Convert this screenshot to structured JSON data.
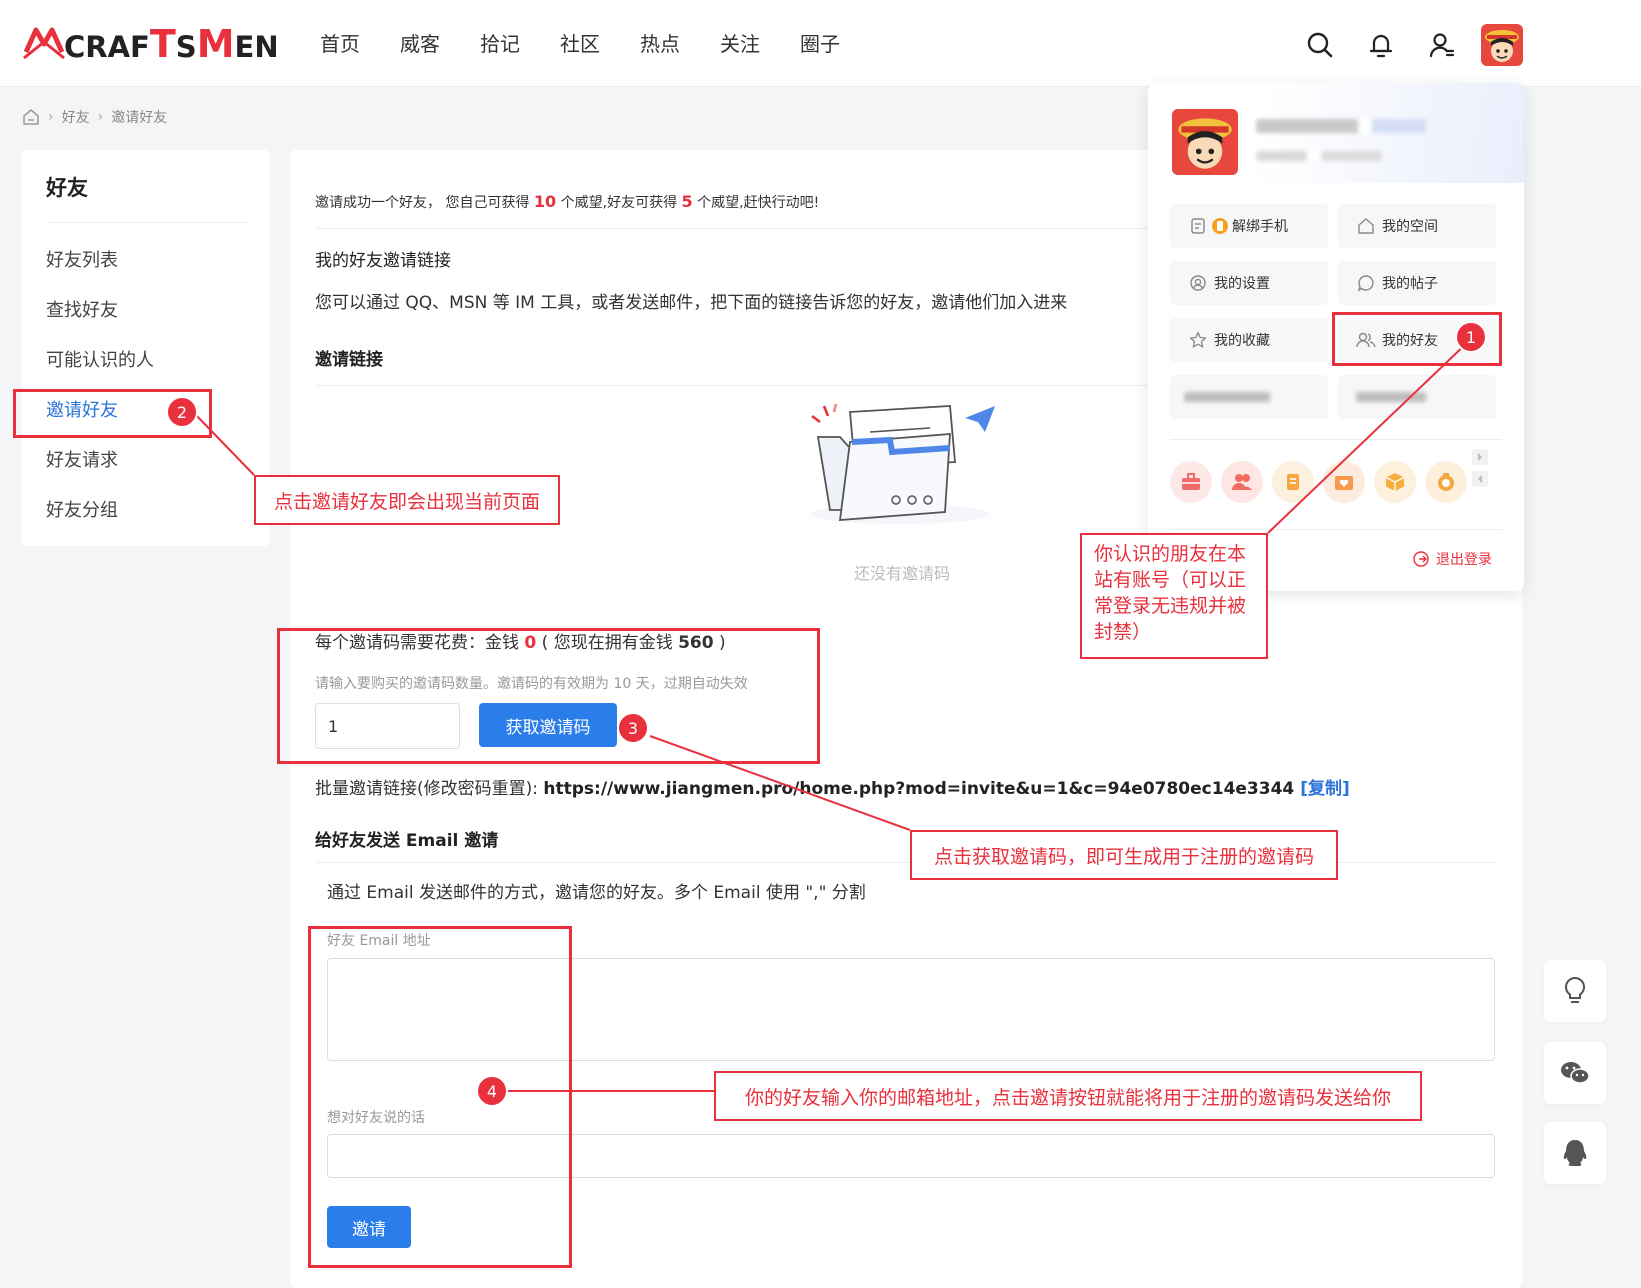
{
  "logo": {
    "text_prefix": "CRAF",
    "text_t": "T",
    "text_mid": "S",
    "text_m": "M",
    "text_suffix": "EN"
  },
  "nav": [
    "首页",
    "威客",
    "拾记",
    "社区",
    "热点",
    "关注",
    "圈子"
  ],
  "header_icons": [
    "search-icon",
    "bell-icon",
    "user-icon",
    "avatar"
  ],
  "breadcrumb": {
    "items": [
      "好友",
      "邀请好友"
    ]
  },
  "sidebar": {
    "title": "好友",
    "items": [
      "好友列表",
      "查找好友",
      "可能认识的人",
      "邀请好友",
      "好友请求",
      "好友分组"
    ],
    "active_index": 3
  },
  "main": {
    "tip": {
      "part1": "邀请成功一个好友， 您自己可获得 ",
      "num1": "10",
      "part2": " 个威望,好友可获得 ",
      "num2": "5",
      "part3": " 个威望,赶快行动吧!"
    },
    "my_link_title": "我的好友邀请链接",
    "my_link_desc": "您可以通过 QQ、MSN 等 IM 工具，或者发送邮件，把下面的链接告诉您的好友，邀请他们加入进来",
    "invite_link_title": "邀请链接",
    "empty_text": "还没有邀请码",
    "cost": {
      "part1": "每个邀请码需要花费：金钱 ",
      "price": "0",
      "part2": " ( 您现在拥有金钱 ",
      "owned": "560",
      "part3": " )"
    },
    "cost_hint": "请输入要购买的邀请码数量。邀请码的有效期为 10 天，过期自动失效",
    "qty_value": "1",
    "get_code_button": "获取邀请码",
    "batch_label": "批量邀请链接(修改密码重置): ",
    "batch_url": "https://www.jiangmen.pro/home.php?mod=invite&u=1&c=94e0780ec14e3344",
    "copy_label": "[复制]",
    "email_title": "给好友发送 Email 邀请",
    "email_desc": "通过 Email 发送邮件的方式，邀请您的好友。多个 Email 使用 \",\" 分割",
    "email_label": "好友 Email 地址",
    "message_label": "想对好友说的话",
    "invite_button": "邀请"
  },
  "panel": {
    "buttons": [
      {
        "label": "解绑手机",
        "icon": "phone-icon"
      },
      {
        "label": "我的空间",
        "icon": "home-icon"
      },
      {
        "label": "我的设置",
        "icon": "settings-icon"
      },
      {
        "label": "我的帖子",
        "icon": "chat-icon"
      },
      {
        "label": "我的收藏",
        "icon": "star-icon"
      },
      {
        "label": "我的好友",
        "icon": "friends-icon"
      }
    ],
    "round_icon_colors": [
      "#f06a6a",
      "#f26b60",
      "#f7a541",
      "#f79a4c",
      "#f7ad3c",
      "#f5a742"
    ],
    "logout": "退出登录"
  },
  "annotations": {
    "note1": "你认识的朋友在本站有账号（可以正常登录无违规并被封禁）",
    "note2": "点击邀请好友即会出现当前页面",
    "note3": "点击获取邀请码，即可生成用于注册的邀请码",
    "note4": "你的好友输入你的邮箱地址，点击邀请按钮就能将用于注册的邀请码发送给你",
    "badges": [
      "1",
      "2",
      "3",
      "4"
    ]
  },
  "colors": {
    "accent": "#2b7de9",
    "annotation": "#e8313d",
    "active_link": "#2a74d9"
  }
}
